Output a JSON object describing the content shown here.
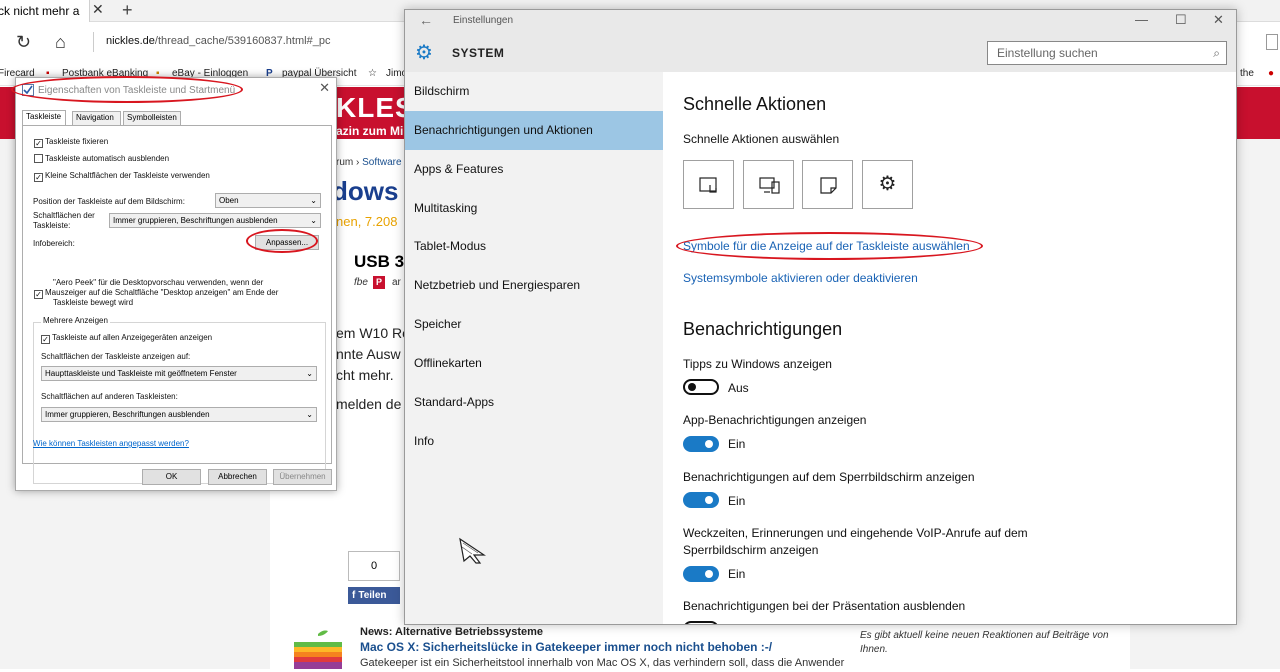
{
  "browser": {
    "tab_title": "ck nicht mehr a",
    "url_domain": "nickles.de",
    "url_path": "/thread_cache/539160837.html#_pc",
    "favorites": [
      "Firecard",
      "Postbank eBanking",
      "eBay - Einloggen",
      "paypal Übersicht",
      "Jimo",
      "the"
    ],
    "colors": {
      "site_red": "#c8102e",
      "link_blue": "#1a4f8e"
    }
  },
  "site": {
    "logo": "KLES",
    "tagline": "azin zum Mi",
    "breadcrumb_prefix": "rum › ",
    "breadcrumb_link": "Software",
    "title_fragment": "dows",
    "date_fragment": "nen, 7.208",
    "usb_fragment": "USB 3",
    "author": "fbe",
    "badge": "P",
    "an": "ar",
    "body_lines": [
      "em W10 Ro",
      "nnte Ausw",
      "cht mehr.",
      "melden de"
    ],
    "share_count": "0",
    "share_label": "Teilen",
    "news_meta": "News: Alternative Betriebssysteme",
    "news_title": "Mac OS X: Sicherheitslücke in Gatekeeper immer noch nicht behoben :-/",
    "news_body": "Gatekeeper ist ein Sicherheitstool innerhalb von Mac OS X, das verhindern soll, dass die Anwender",
    "side_note": "Es gibt aktuell keine neuen Reaktionen auf Beiträge von Ihnen."
  },
  "taskbar_dialog": {
    "title": "Eigenschaften von Taskleiste und Startmenü",
    "tabs": [
      "Taskleiste",
      "Navigation",
      "Symbolleisten"
    ],
    "checkboxes": [
      {
        "label": "Taskleiste fixieren",
        "checked": true
      },
      {
        "label": "Taskleiste automatisch ausblenden",
        "checked": false
      },
      {
        "label": "Kleine Schaltflächen der Taskleiste verwenden",
        "checked": true
      }
    ],
    "position_label": "Position der Taskleiste auf dem Bildschirm:",
    "position_value": "Oben",
    "buttons_label_1": "Schaltflächen der",
    "buttons_label_2": "Taskleiste:",
    "buttons_value": "Immer gruppieren, Beschriftungen ausblenden",
    "infobereich_label": "Infobereich:",
    "anpassen": "Anpassen...",
    "aero_line1": "\"Aero Peek\" für die Desktopvorschau verwenden, wenn der",
    "aero_line2": "Mauszeiger auf die Schaltfläche \"Desktop anzeigen\" am Ende der",
    "aero_line3": "Taskleiste bewegt wird",
    "aero_checked": true,
    "group_title": "Mehrere Anzeigen",
    "multi_check": "Taskleiste auf allen Anzeigegeräten anzeigen",
    "multi_checked": true,
    "show_on_label": "Schaltflächen der Taskleiste anzeigen auf:",
    "show_on_value": "Haupttaskleiste und Taskleiste mit geöffnetem Fenster",
    "other_label": "Schaltflächen auf anderen Taskleisten:",
    "other_value": "Immer gruppieren, Beschriftungen ausblenden",
    "help_link": "Wie können Taskleisten angepasst werden?",
    "ok": "OK",
    "cancel": "Abbrechen",
    "apply": "Übernehmen",
    "annotation_color": "#d8161f"
  },
  "settings": {
    "window_title": "Einstellungen",
    "section": "SYSTEM",
    "search_placeholder": "Einstellung suchen",
    "nav": [
      "Bildschirm",
      "Benachrichtigungen und Aktionen",
      "Apps & Features",
      "Multitasking",
      "Tablet-Modus",
      "Netzbetrieb und Energiesparen",
      "Speicher",
      "Offlinekarten",
      "Standard-Apps",
      "Info"
    ],
    "selected_nav": "Benachrichtigungen und Aktionen",
    "quick_title": "Schnelle Aktionen",
    "quick_sub": "Schnelle Aktionen auswählen",
    "quick_icons": [
      "tablet-mode-icon",
      "connect-icon",
      "note-icon",
      "settings-gear-icon"
    ],
    "link1": "Symbole für die Anzeige auf der Taskleiste auswählen",
    "link2": "Systemsymbole aktivieren oder deaktivieren",
    "notif_title": "Benachrichtigungen",
    "toggles": [
      {
        "label": "Tipps zu Windows anzeigen",
        "state": "Aus",
        "on": false
      },
      {
        "label": "App-Benachrichtigungen anzeigen",
        "state": "Ein",
        "on": true
      },
      {
        "label": "Benachrichtigungen auf dem Sperrbildschirm anzeigen",
        "state": "Ein",
        "on": true
      },
      {
        "label_line1": "Weckzeiten, Erinnerungen und eingehende VoIP-Anrufe auf dem",
        "label_line2": "Sperrbildschirm anzeigen",
        "state": "Ein",
        "on": true
      },
      {
        "label": "Benachrichtigungen bei der Präsentation ausblenden"
      }
    ],
    "accent": "#1a7ac6",
    "selected_bg": "#9cc6e4"
  }
}
